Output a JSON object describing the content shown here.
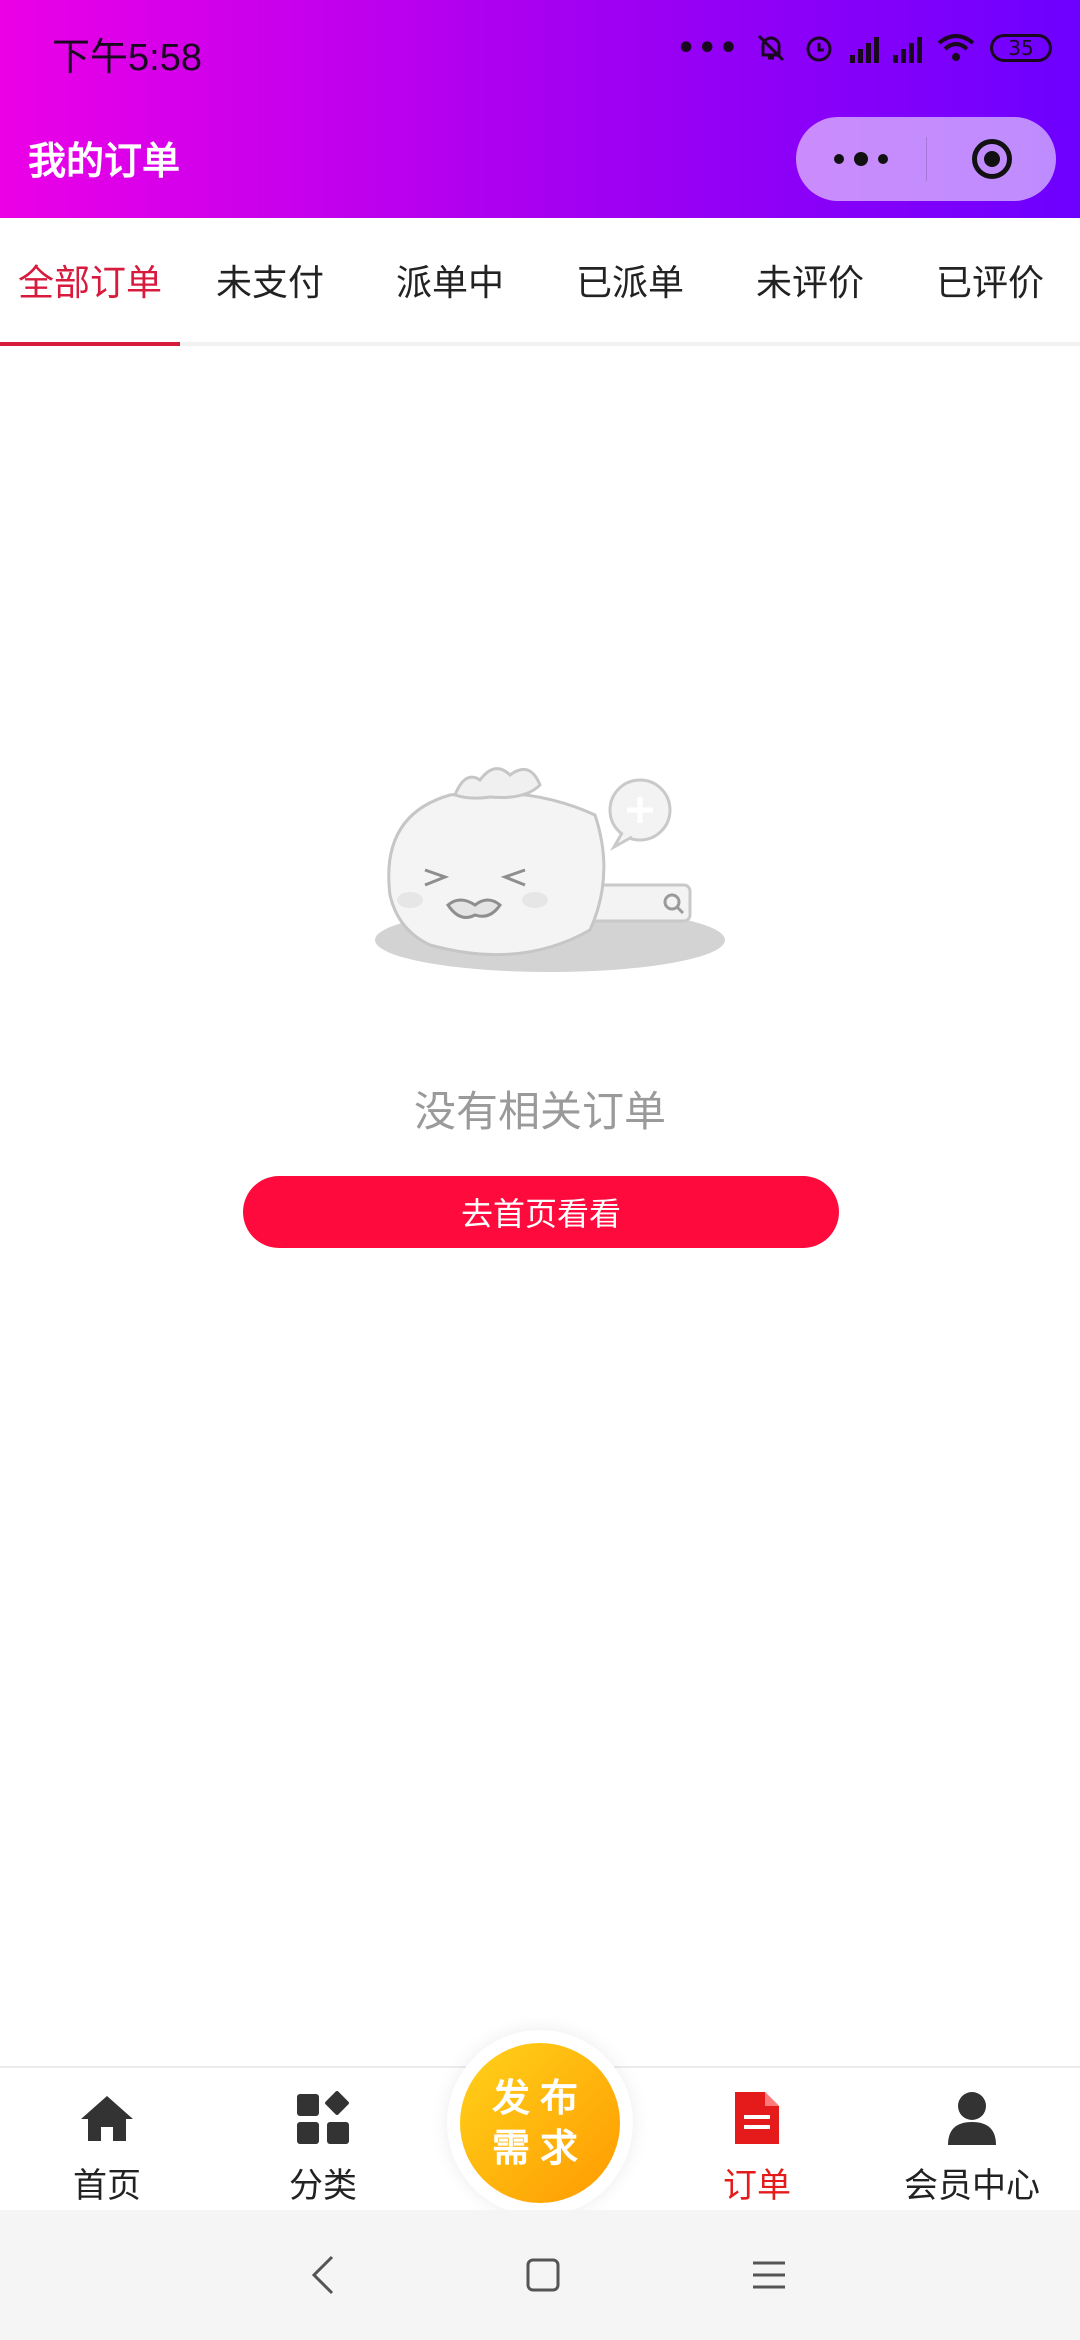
{
  "status_bar": {
    "time": "下午5:58",
    "battery": "35"
  },
  "header": {
    "title": "我的订单"
  },
  "tabs": [
    {
      "label": "全部订单",
      "active": true
    },
    {
      "label": "未支付",
      "active": false
    },
    {
      "label": "派单中",
      "active": false
    },
    {
      "label": "已派单",
      "active": false
    },
    {
      "label": "未评价",
      "active": false
    },
    {
      "label": "已评价",
      "active": false
    }
  ],
  "empty_state": {
    "message": "没有相关订单",
    "button_label": "去首页看看"
  },
  "tabbar": {
    "items": [
      {
        "label": "首页",
        "icon": "home-icon"
      },
      {
        "label": "分类",
        "icon": "category-icon"
      },
      {
        "label": "订单",
        "icon": "order-icon",
        "active": true
      },
      {
        "label": "会员中心",
        "icon": "user-icon"
      }
    ],
    "publish": {
      "line1": "发布",
      "line2": "需求"
    }
  },
  "colors": {
    "accent": "#d81a3c",
    "button": "#ff0a3c",
    "header_start": "#ec00e6",
    "header_end": "#6d00ff",
    "publish": "#ffb400"
  }
}
